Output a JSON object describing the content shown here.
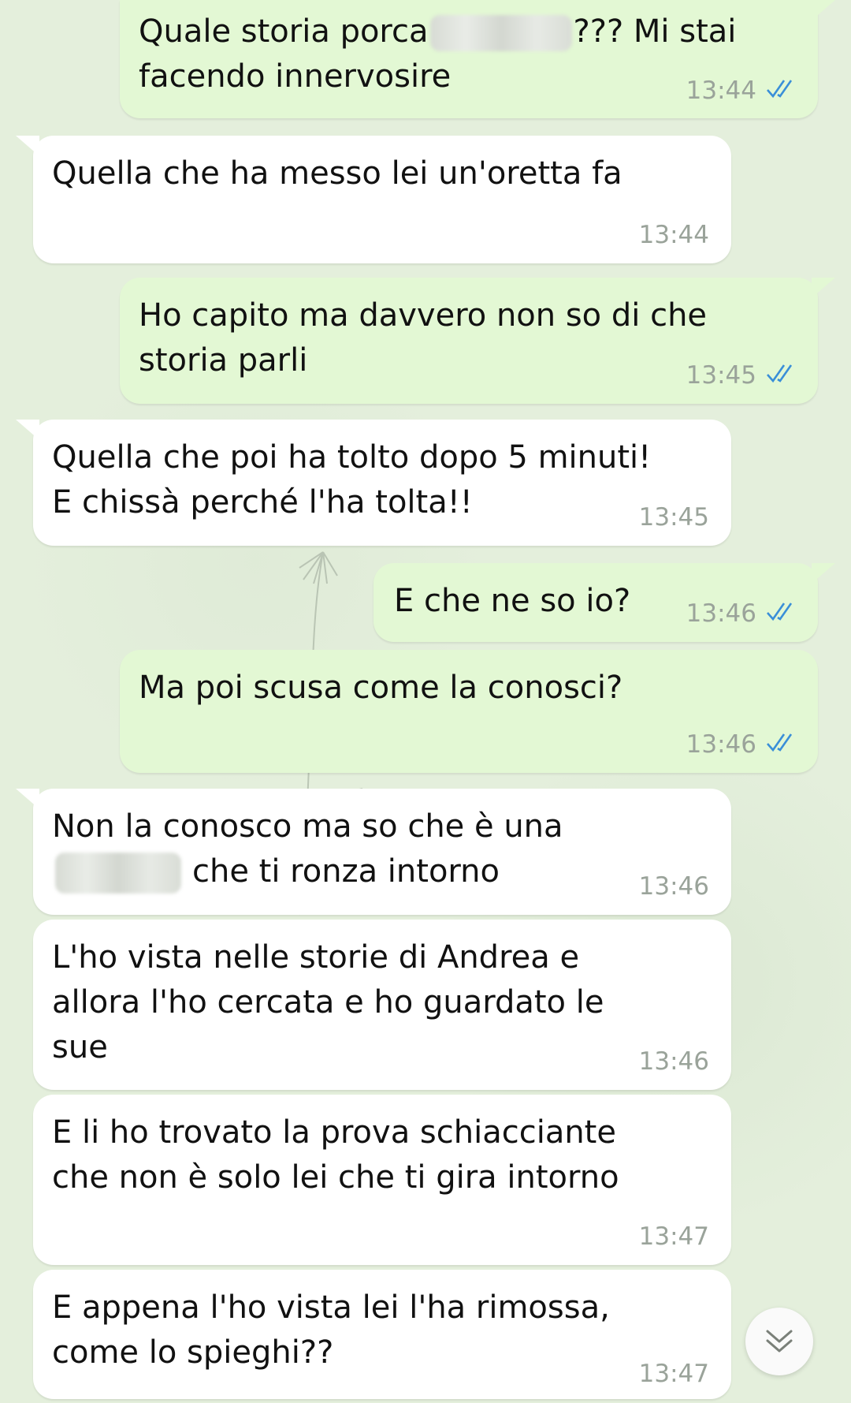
{
  "messages": [
    {
      "dir": "out",
      "text_before": "Quale storia porca",
      "redacted": true,
      "text_after": "??? Mi stai\nfacendo innervosire",
      "time": "13:44",
      "status": "read"
    },
    {
      "dir": "in",
      "text": "Quella che ha messo lei un'oretta fa",
      "time": "13:44"
    },
    {
      "dir": "out",
      "text": "Ho capito ma davvero non so di che\nstoria parli",
      "time": "13:45",
      "status": "read"
    },
    {
      "dir": "in",
      "text": "Quella che poi ha tolto dopo 5 minuti!\nE chissà perché l'ha tolta!!",
      "time": "13:45"
    },
    {
      "dir": "out",
      "text": "E che ne so io?",
      "time": "13:46",
      "status": "read"
    },
    {
      "dir": "out",
      "text": "Ma poi scusa come la conosci?",
      "time": "13:46",
      "status": "read"
    },
    {
      "dir": "in",
      "text_before": "Non la conosco ma so che è una",
      "redacted": true,
      "text_after": "che ti ronza intorno",
      "time": "13:46"
    },
    {
      "dir": "in",
      "text": "L'ho vista nelle storie di Andrea e\nallora l'ho cercata e ho guardato le\nsue",
      "time": "13:46"
    },
    {
      "dir": "in",
      "text": "E li ho trovato la prova schiacciante\nche non è solo lei che ti gira intorno",
      "time": "13:47"
    },
    {
      "dir": "in",
      "text": "E appena l'ho vista lei l'ha rimossa,\ncome lo spieghi??",
      "time": "13:47"
    }
  ],
  "icons": {
    "read_ticks": "double-check-icon",
    "scroll_down": "double-chevron-down-icon"
  },
  "colors": {
    "background": "#e4efdc",
    "outgoing_bubble": "#e3f8d4",
    "incoming_bubble": "#ffffff",
    "tick_blue": "#3a8fd8",
    "timestamp": "#9aa39a"
  }
}
